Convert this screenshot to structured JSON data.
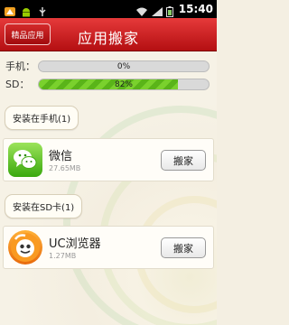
{
  "status_bar": {
    "time": "15:40",
    "icons": [
      "notification-icon",
      "android-icon",
      "usb-icon",
      "wifi-icon",
      "signal-icon",
      "battery-icon"
    ]
  },
  "header": {
    "title": "应用搬家",
    "featured_label": "精品应用"
  },
  "storage": {
    "phone": {
      "label": "手机：",
      "percent_text": "0%",
      "percent": 0
    },
    "sd": {
      "label": "SD：",
      "percent_text": "82%",
      "percent": 82
    }
  },
  "sections": {
    "phone_title": "安装在手机(1)",
    "sd_title": "安装在SD卡(1)"
  },
  "apps": {
    "phone": [
      {
        "name": "微信",
        "size": "27.65MB",
        "action": "搬家",
        "icon": "wechat-icon"
      }
    ],
    "sd": [
      {
        "name": "UC浏览器",
        "size": "1.27MB",
        "action": "搬家",
        "icon": "uc-browser-icon"
      }
    ]
  },
  "colors": {
    "header_red": "#c81e20",
    "progress_green": "#6cc523",
    "background": "#f4efe2"
  }
}
